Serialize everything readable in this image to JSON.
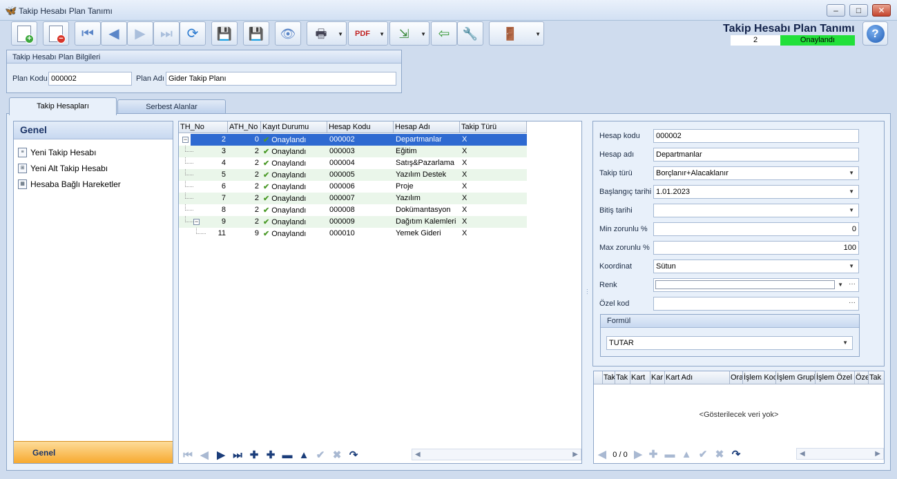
{
  "window": {
    "title": "Takip Hesabı Plan Tanımı"
  },
  "header": {
    "title": "Takip Hesabı Plan Tanımı",
    "record_number": "2",
    "status": "Onaylandı"
  },
  "plan_info": {
    "group_title": "Takip Hesabı Plan Bilgileri",
    "code_label": "Plan Kodu",
    "code_value": "000002",
    "name_label": "Plan Adı",
    "name_value": "Gider Takip Planı"
  },
  "tabs": [
    {
      "label": "Takip Hesapları"
    },
    {
      "label": "Serbest Alanlar"
    }
  ],
  "left_panel": {
    "title": "Genel",
    "items": [
      {
        "label": "Yeni Takip Hesabı"
      },
      {
        "label": "Yeni Alt Takip Hesabı"
      },
      {
        "label": "Hesaba Bağlı Hareketler"
      }
    ],
    "footer": "Genel"
  },
  "grid": {
    "columns": [
      "TH_No",
      "ATH_No",
      "Kayıt Durumu",
      "Hesap Kodu",
      "Hesap Adı",
      "Takip Türü"
    ],
    "rows": [
      {
        "th": "2",
        "ath": "0",
        "status": "Onaylandı",
        "code": "000002",
        "name": "Departmanlar",
        "type": "X"
      },
      {
        "th": "3",
        "ath": "2",
        "status": "Onaylandı",
        "code": "000003",
        "name": "Eğitim",
        "type": "X"
      },
      {
        "th": "4",
        "ath": "2",
        "status": "Onaylandı",
        "code": "000004",
        "name": "Satış&Pazarlama",
        "type": "X"
      },
      {
        "th": "5",
        "ath": "2",
        "status": "Onaylandı",
        "code": "000005",
        "name": "Yazılım Destek",
        "type": "X"
      },
      {
        "th": "6",
        "ath": "2",
        "status": "Onaylandı",
        "code": "000006",
        "name": "Proje",
        "type": "X"
      },
      {
        "th": "7",
        "ath": "2",
        "status": "Onaylandı",
        "code": "000007",
        "name": "Yazılım",
        "type": "X"
      },
      {
        "th": "8",
        "ath": "2",
        "status": "Onaylandı",
        "code": "000008",
        "name": "Dokümantasyon",
        "type": "X"
      },
      {
        "th": "9",
        "ath": "2",
        "status": "Onaylandı",
        "code": "000009",
        "name": "Dağıtım Kalemleri",
        "type": "X"
      },
      {
        "th": "11",
        "ath": "9",
        "status": "Onaylandı",
        "code": "000010",
        "name": "Yemek Gideri",
        "type": "X"
      }
    ]
  },
  "details": {
    "hesap_kodu": {
      "label": "Hesap kodu",
      "value": "000002"
    },
    "hesap_adi": {
      "label": "Hesap adı",
      "value": "Departmanlar"
    },
    "takip_turu": {
      "label": "Takip türü",
      "value": "Borçlanır+Alacaklanır"
    },
    "baslangic": {
      "label": "Başlangıç tarihi",
      "value": "1.01.2023"
    },
    "bitis": {
      "label": "Bitiş tarihi",
      "value": ""
    },
    "min": {
      "label": "Min zorunlu %",
      "value": "0"
    },
    "max": {
      "label": "Max zorunlu %",
      "value": "100"
    },
    "koordinat": {
      "label": "Koordinat",
      "value": "Sütun"
    },
    "renk": {
      "label": "Renk",
      "value": ""
    },
    "ozel_kod": {
      "label": "Özel kod",
      "value": ""
    },
    "formul": {
      "title": "Formül",
      "value": "TUTAR"
    }
  },
  "detail_grid": {
    "columns": [
      "Tak",
      "Tak",
      "Kart",
      "Kar",
      "Kart Adı",
      "Ora",
      "İşlem Kod",
      "İşlem Grupl",
      "İşlem Özel",
      "Öze",
      "Tak"
    ],
    "empty_text": "<Gösterilecek veri yok>",
    "record_counter": "0 / 0"
  },
  "colors": {
    "accent": "#2e6ad1",
    "status_green": "#22e03a",
    "footer_orange": "#f7a92f"
  }
}
